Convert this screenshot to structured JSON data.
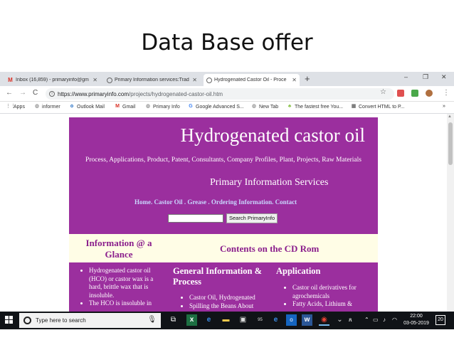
{
  "slide": {
    "title": "Data Base offer"
  },
  "browser": {
    "tabs": [
      {
        "label": "Inbox (16,859) - primaryinfo@gm",
        "icon": "gmail-icon"
      },
      {
        "label": "Primary Information services:Trad",
        "icon": "globe-icon"
      },
      {
        "label": "Hydrogenated Castor Oil - Proce",
        "icon": "globe-icon"
      }
    ],
    "new_tab": "+",
    "window_controls": {
      "minimize": "–",
      "maximize": "❐",
      "close": "✕"
    },
    "nav": {
      "back": "←",
      "forward": "→",
      "reload": "C"
    },
    "url": {
      "host": "https://www.primaryinfo.com",
      "path": "/projects/hydrogenated-castor-oil.htm"
    },
    "bookmarks": [
      {
        "label": "Apps",
        "icon": "apps-grid-icon"
      },
      {
        "label": "informer",
        "icon": "globe-icon"
      },
      {
        "label": "Outlook Mail",
        "icon": "outlook-icon"
      },
      {
        "label": "Gmail",
        "icon": "gmail-icon"
      },
      {
        "label": "Primary Info",
        "icon": "globe-icon"
      },
      {
        "label": "Google Advanced S...",
        "icon": "google-icon"
      },
      {
        "label": "New Tab",
        "icon": "globe-icon"
      },
      {
        "label": "The fastest free You...",
        "icon": "bookmark-leaf-icon"
      },
      {
        "label": "Convert HTML to P...",
        "icon": "convert-icon"
      }
    ],
    "bookmarks_overflow": "»"
  },
  "page": {
    "title": "Hydrogenated castor oil",
    "subtitle": "Process, Applications, Product, Patent, Consultants, Company Profiles, Plant, Projects, Raw Materials",
    "company": "Primary Information Services",
    "nav": {
      "home": "Home",
      "castor_oil": "Castor Oil",
      "grease": "Grease",
      "ordering": "Ordering Information",
      "contact": "Contact",
      "sep_dot": ". ",
      "sep_dot_space": " . ",
      "sep_dot2": ". "
    },
    "search": {
      "value": "",
      "button": "Search PrimaryInfo"
    },
    "info_heading": "Information @ a Glance",
    "cd_heading": "Contents on the CD Rom",
    "left_items": [
      "Hydrogenated castor oil (HCO) or castor wax is a hard, brittle wax that is insoluble.",
      "The HCO is insoluble in"
    ],
    "general_heading": "General Information & Process",
    "general_items": [
      "Castor Oil, Hydrogenated",
      "Spilling the Beans About"
    ],
    "application_heading": "Application",
    "application_items": [
      "Castor oil derivatives for agrochemicals",
      "Fatty Acids, Lithium &"
    ]
  },
  "taskbar": {
    "search_placeholder": "Type here to search",
    "time": "22:00",
    "date": "03-05-2019",
    "notifications": "20",
    "badge": "95"
  }
}
